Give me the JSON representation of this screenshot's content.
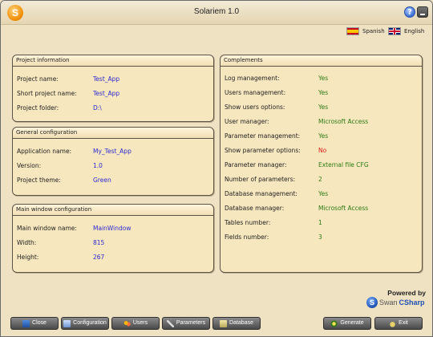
{
  "window": {
    "title": "Solariem 1.0",
    "logo_letter": "S"
  },
  "languages": [
    {
      "label": "Spanish",
      "flag": "flag-es-icon"
    },
    {
      "label": "English",
      "flag": "flag-gb-icon"
    }
  ],
  "project_info": {
    "header": "Project information",
    "rows": [
      {
        "label": "Project name:",
        "value": "Test_App"
      },
      {
        "label": "Short project name:",
        "value": "Test_App"
      },
      {
        "label": "Project folder:",
        "value": "D:\\"
      }
    ]
  },
  "general_config": {
    "header": "General configuration",
    "rows": [
      {
        "label": "Application name:",
        "value": "My_Test_App"
      },
      {
        "label": "Version:",
        "value": "1.0"
      },
      {
        "label": "Project theme:",
        "value": "Green"
      }
    ]
  },
  "main_window_config": {
    "header": "Main window configuration",
    "rows": [
      {
        "label": "Main window name:",
        "value": "MainWindow"
      },
      {
        "label": "Width:",
        "value": "815"
      },
      {
        "label": "Height:",
        "value": "267"
      }
    ]
  },
  "complements": {
    "header": "Complements",
    "rows": [
      {
        "label": "Log management:",
        "value": "Yes"
      },
      {
        "label": "Users management:",
        "value": "Yes"
      },
      {
        "label": "Show users options:",
        "value": "Yes"
      },
      {
        "label": "User manager:",
        "value": "Microsoft Access"
      },
      {
        "label": "Parameter management:",
        "value": "Yes"
      },
      {
        "label": "Show parameter options:",
        "value": "No"
      },
      {
        "label": "Parameter manager:",
        "value": "External file CFG"
      },
      {
        "label": "Number of parameters:",
        "value": "2"
      },
      {
        "label": "Database management:",
        "value": "Yes"
      },
      {
        "label": "Database manager:",
        "value": "Microsoft Access"
      },
      {
        "label": "Tables number:",
        "value": "1"
      },
      {
        "label": "Fields number:",
        "value": "3"
      }
    ]
  },
  "branding": {
    "powered_by": "Powered by",
    "brand_part1": "Swan",
    "brand_part2": "CSharp"
  },
  "buttons": {
    "close": "Close",
    "configuration": "Configuration",
    "users": "Users",
    "parameters": "Parameters",
    "database": "Database",
    "generate": "Generate",
    "exit": "Exit"
  },
  "colors": {
    "background": "#efe2c3",
    "panel": "#f7e7bf",
    "value_blue": "#2a2ad0",
    "value_green": "#2b7a12",
    "value_red": "#e01818"
  }
}
